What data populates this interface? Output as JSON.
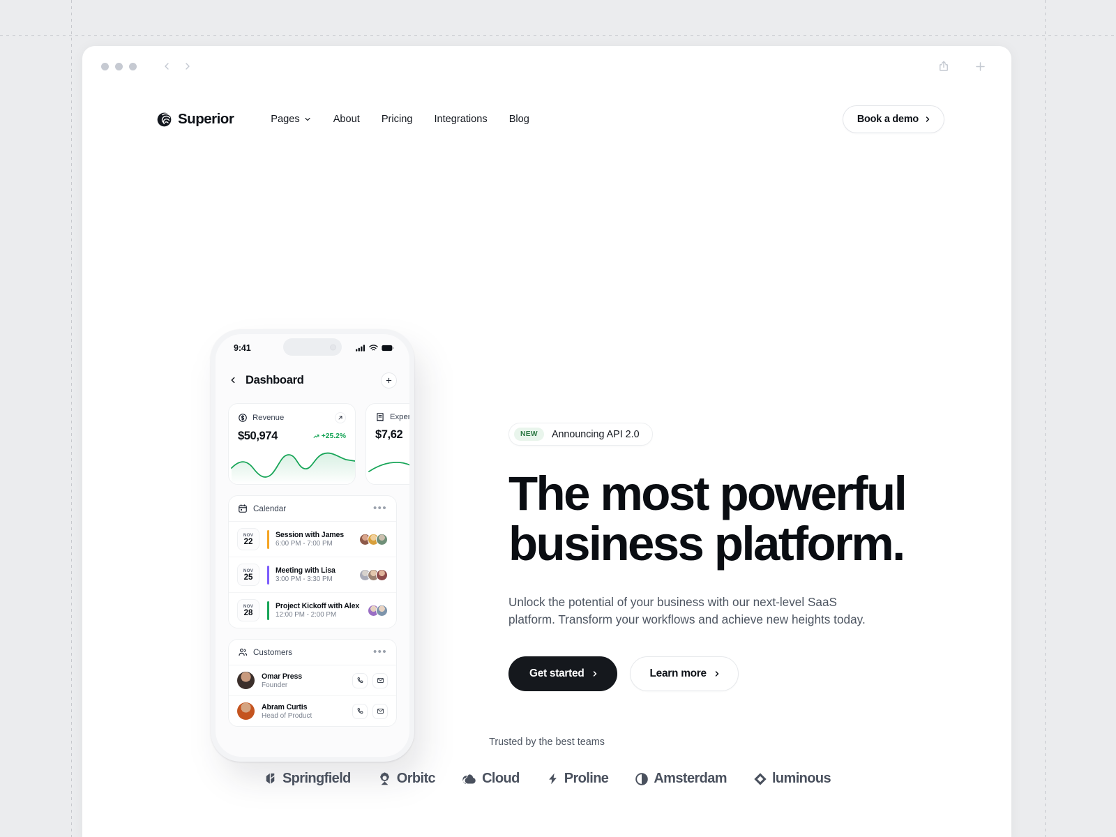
{
  "browser": {
    "traffic_lights": [
      "red",
      "yellow",
      "green"
    ],
    "back_icon": "chevron-left-icon",
    "forward_icon": "chevron-right-icon",
    "share_icon": "share-icon",
    "new_tab_icon": "plus-icon"
  },
  "header": {
    "logo_mark": "spiral-logo-icon",
    "logo_text": "Superior",
    "nav": [
      {
        "label": "Pages",
        "has_caret": true
      },
      {
        "label": "About",
        "has_caret": false
      },
      {
        "label": "Pricing",
        "has_caret": false
      },
      {
        "label": "Integrations",
        "has_caret": false
      },
      {
        "label": "Blog",
        "has_caret": false
      }
    ],
    "cta": {
      "label": "Book a demo",
      "icon": "chevron-right-icon"
    }
  },
  "hero": {
    "badge": {
      "tag": "NEW",
      "text": "Announcing API 2.0"
    },
    "title_line1": "The most powerful",
    "title_line2": "business platform.",
    "subtitle": "Unlock the potential of your business with our next-level SaaS platform. Transform your workflows and achieve new heights today.",
    "primary_cta": {
      "label": "Get started",
      "icon": "chevron-right-icon"
    },
    "secondary_cta": {
      "label": "Learn more",
      "icon": "chevron-right-icon"
    }
  },
  "phone": {
    "status": {
      "time": "9:41",
      "signal_icon": "cellular-signal-icon",
      "wifi_icon": "wifi-icon",
      "battery_icon": "battery-full-icon"
    },
    "topbar": {
      "back_icon": "chevron-left-icon",
      "title": "Dashboard",
      "add_icon": "plus-icon"
    },
    "stats": [
      {
        "icon": "dollar-circle-icon",
        "label": "Revenue",
        "value": "$50,974",
        "delta": "+25.2%",
        "delta_icon": "trend-up-icon",
        "expand_icon": "arrow-up-right-icon",
        "accent": "#1a9c53"
      },
      {
        "icon": "receipt-icon",
        "label": "Expenses",
        "value": "$7,62",
        "delta": "",
        "delta_icon": "trend-up-icon",
        "expand_icon": "arrow-up-right-icon",
        "accent": "#1a9c53"
      }
    ],
    "calendar": {
      "icon": "calendar-icon",
      "title": "Calendar",
      "more_icon": "ellipsis-icon",
      "events": [
        {
          "month": "NOV",
          "day": "22",
          "title": "Session with James",
          "time": "6:00 PM - 7:00 PM",
          "bar_color": "#f5a524",
          "avatars": [
            "#8d5a4a",
            "#d8a03c",
            "#6f8f78"
          ]
        },
        {
          "month": "NOV",
          "day": "25",
          "title": "Meeting with Lisa",
          "time": "3:00 PM - 3:30 PM",
          "bar_color": "#7c5cfc",
          "avatars": [
            "#a9abb8",
            "#9b8272",
            "#8d4a4a"
          ]
        },
        {
          "month": "NOV",
          "day": "28",
          "title": "Project Kickoff with Alex",
          "time": "12:00 PM - 2:00 PM",
          "bar_color": "#18a558",
          "avatars": [
            "#9a6fc4",
            "#7d94ab"
          ]
        }
      ]
    },
    "customers": {
      "icon": "users-icon",
      "title": "Customers",
      "more_icon": "ellipsis-icon",
      "people": [
        {
          "name": "Omar Press",
          "role": "Founder",
          "avatar_color": "#4a3c38",
          "call_icon": "phone-icon",
          "mail_icon": "envelope-icon"
        },
        {
          "name": "Abram Curtis",
          "role": "Head of Product",
          "avatar_color": "#c4541f",
          "call_icon": "phone-icon",
          "mail_icon": "envelope-icon"
        }
      ]
    }
  },
  "trusted": {
    "label": "Trusted by the best teams",
    "brands": [
      {
        "name": "Springfield",
        "icon": "springfield-leaf-icon"
      },
      {
        "name": "Orbitc",
        "icon": "orbitc-star-icon"
      },
      {
        "name": "Cloud",
        "icon": "cloud-icon"
      },
      {
        "name": "Proline",
        "icon": "bolt-icon"
      },
      {
        "name": "Amsterdam",
        "icon": "half-circle-icon"
      },
      {
        "name": "luminous",
        "icon": "diamond-icon"
      }
    ]
  },
  "colors": {
    "page_bg": "#ebecee",
    "surface": "#ffffff",
    "ink": "#0a0d12",
    "muted": "#4e5662",
    "accent_green": "#18a558",
    "badge_green_bg": "#e9f5ec",
    "badge_green_fg": "#2f7a46",
    "brand_gray": "#4a515e"
  }
}
